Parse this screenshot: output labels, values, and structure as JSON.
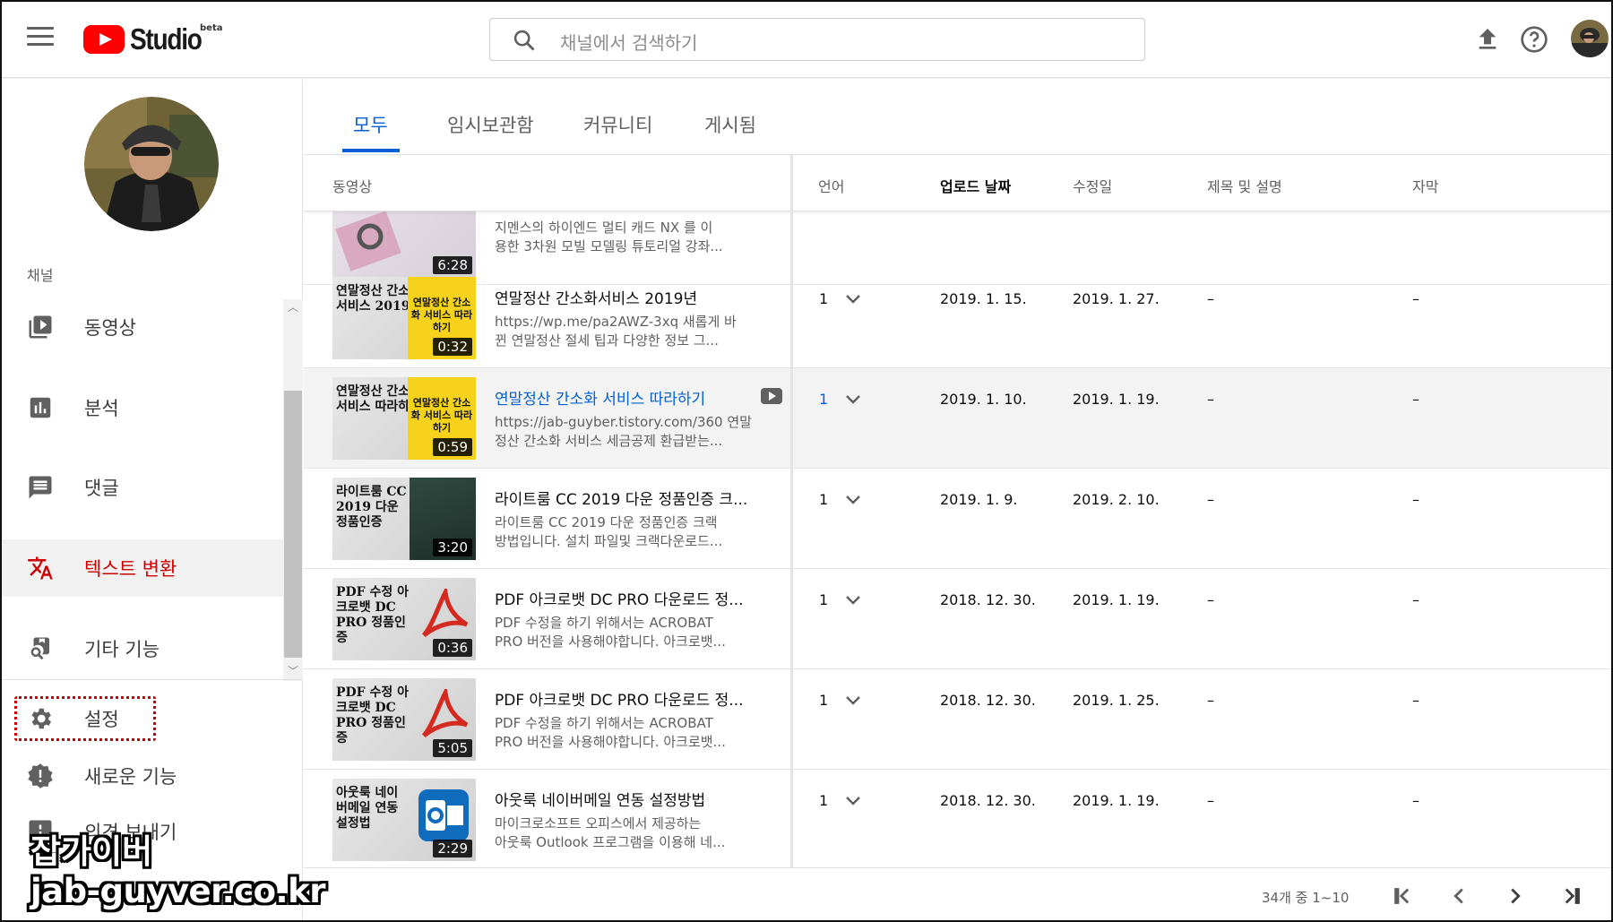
{
  "header": {
    "logo_text": "Studio",
    "logo_badge": "beta",
    "search_placeholder": "채널에서 검색하기"
  },
  "sidebar": {
    "section_label": "채널",
    "items": [
      {
        "label": "동영상",
        "icon": "video-library-icon"
      },
      {
        "label": "분석",
        "icon": "analytics-icon"
      },
      {
        "label": "댓글",
        "icon": "comment-icon"
      },
      {
        "label": "텍스트 변환",
        "icon": "translate-icon",
        "active": true
      },
      {
        "label": "기타 기능",
        "icon": "other-features-icon"
      }
    ],
    "bottom_items": [
      {
        "label": "설정",
        "icon": "gear-icon"
      },
      {
        "label": "새로운 기능",
        "icon": "new-features-icon"
      },
      {
        "label": "의견 보내기",
        "icon": "feedback-icon"
      }
    ]
  },
  "tabs": [
    {
      "label": "모두",
      "active": true
    },
    {
      "label": "임시보관함"
    },
    {
      "label": "커뮤니티"
    },
    {
      "label": "게시됨"
    }
  ],
  "table": {
    "headers": {
      "video": "동영상",
      "language": "언어",
      "upload_date": "업로드 날짜",
      "modified": "수정일",
      "title_desc": "제목 및 설명",
      "subtitles": "자막"
    },
    "partial_row": {
      "duration": "6:28",
      "desc1": "지멘스의 하이엔드 멀티 캐드 NX 를 이",
      "desc2": "용한 3차원 모빌 모델링 튜토리얼 강좌..."
    },
    "rows": [
      {
        "thumb_text": "연말정산 간소화서비스 2019년",
        "thumb_badge": "연말정산 간소화 서비스 따라하기",
        "duration": "0:32",
        "title": "연말정산 간소화서비스 2019년",
        "desc1": "https://wp.me/pa2AWZ-3xq 새롭게 바",
        "desc2": "뀐 연말정산 절세 팁과 다양한 정보 그...",
        "lang": "1",
        "upload": "2019. 1. 15.",
        "modified": "2019. 1. 27.",
        "title_status": "–",
        "subs": "–"
      },
      {
        "thumb_text": "연말정산 간소화 서비스 따라하기",
        "thumb_badge": "연말정산 간소화 서비스 따라하기",
        "duration": "0:59",
        "title": "연말정산 간소화 서비스 따라하기",
        "desc1": "https://jab-guyber.tistory.com/360 연말",
        "desc2": "정산 간소화 서비스 세금공제 환급받는...",
        "lang": "1",
        "upload": "2019. 1. 10.",
        "modified": "2019. 1. 19.",
        "title_status": "–",
        "subs": "–"
      },
      {
        "thumb_text": "라이트룸 CC 2019 다운 정품인증",
        "duration": "3:20",
        "title": "라이트룸 CC 2019 다운 정품인증 크...",
        "desc1": "라이트룸 CC 2019 다운 정품인증 크랙",
        "desc2": "방법입니다. 설치 파일및 크랙다운로드...",
        "lang": "1",
        "upload": "2019. 1. 9.",
        "modified": "2019. 2. 10.",
        "title_status": "–",
        "subs": "–"
      },
      {
        "thumb_text": "PDF 수정 아크로뱃 DC PRO 정품인증",
        "duration": "0:36",
        "title": "PDF 아크로뱃 DC PRO 다운로드 정...",
        "desc1": "PDF 수정을 하기 위해서는 ACROBAT",
        "desc2": "PRO 버전을 사용해야합니다. 아크로뱃...",
        "lang": "1",
        "upload": "2018. 12. 30.",
        "modified": "2019. 1. 19.",
        "title_status": "–",
        "subs": "–"
      },
      {
        "thumb_text": "PDF 수정 아크로뱃 DC PRO 정품인증",
        "duration": "5:05",
        "title": "PDF 아크로뱃 DC PRO 다운로드 정...",
        "desc1": "PDF 수정을 하기 위해서는 ACROBAT",
        "desc2": "PRO 버전을 사용해야합니다. 아크로뱃...",
        "lang": "1",
        "upload": "2018. 12. 30.",
        "modified": "2019. 1. 25.",
        "title_status": "–",
        "subs": "–"
      },
      {
        "thumb_text": "아웃룩 네이버메일 연동 설정법",
        "duration": "2:29",
        "title": "아웃룩 네이버메일 연동 설정방법",
        "desc1": "마이크로소프트 오피스에서 제공하는",
        "desc2": "아웃룩 Outlook 프로그램을 이용해 네...",
        "lang": "1",
        "upload": "2018. 12. 30.",
        "modified": "2019. 1. 19.",
        "title_status": "–",
        "subs": "–"
      }
    ]
  },
  "pagination": {
    "text": "34개 중 1~10"
  },
  "watermark": {
    "line1": "잡가이버",
    "line2": "jab-guyver.co.kr"
  },
  "colors": {
    "accent": "#065fd4",
    "active_nav": "#cc0000",
    "logo_red": "#ff0000"
  }
}
